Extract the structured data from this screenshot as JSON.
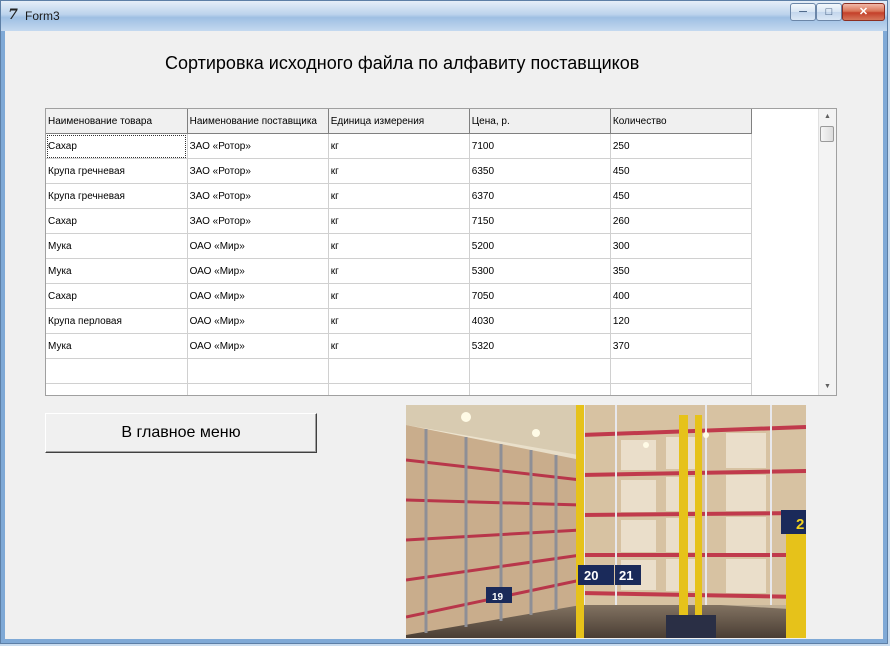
{
  "window": {
    "title": "Form3",
    "min": "─",
    "max": "□",
    "close": "✕"
  },
  "heading": "Сортировка исходного файла по алфавиту поставщиков",
  "table": {
    "columns": [
      "Наименование товара",
      "Наименование поставщика",
      "Единица измерения",
      "Цена, р.",
      "Количество"
    ],
    "rows": [
      [
        "Сахар",
        "ЗАО «Ротор»",
        "кг",
        "7100",
        "250"
      ],
      [
        "Крупа гречневая",
        "ЗАО «Ротор»",
        "кг",
        "6350",
        "450"
      ],
      [
        "Крупа гречневая",
        "ЗАО «Ротор»",
        "кг",
        "6370",
        "450"
      ],
      [
        "Сахар",
        "ЗАО «Ротор»",
        "кг",
        "7150",
        "260"
      ],
      [
        "Мука",
        "ОАО «Мир»",
        "кг",
        "5200",
        "300"
      ],
      [
        "Мука",
        "ОАО «Мир»",
        "кг",
        "5300",
        "350"
      ],
      [
        "Сахар",
        "ОАО «Мир»",
        "кг",
        "7050",
        "400"
      ],
      [
        "Крупа перловая",
        "ОАО «Мир»",
        "кг",
        "4030",
        "120"
      ],
      [
        "Мука",
        "ОАО «Мир»",
        "кг",
        "5320",
        "370"
      ],
      [
        "",
        "",
        "",
        "",
        ""
      ],
      [
        "",
        "",
        "",
        "",
        ""
      ]
    ]
  },
  "scrollbar": {
    "up": "▲",
    "down": "▼"
  },
  "button": {
    "label": "В главное меню"
  },
  "photo": {
    "rack_labels": [
      "20",
      "21",
      "2",
      "19"
    ]
  }
}
